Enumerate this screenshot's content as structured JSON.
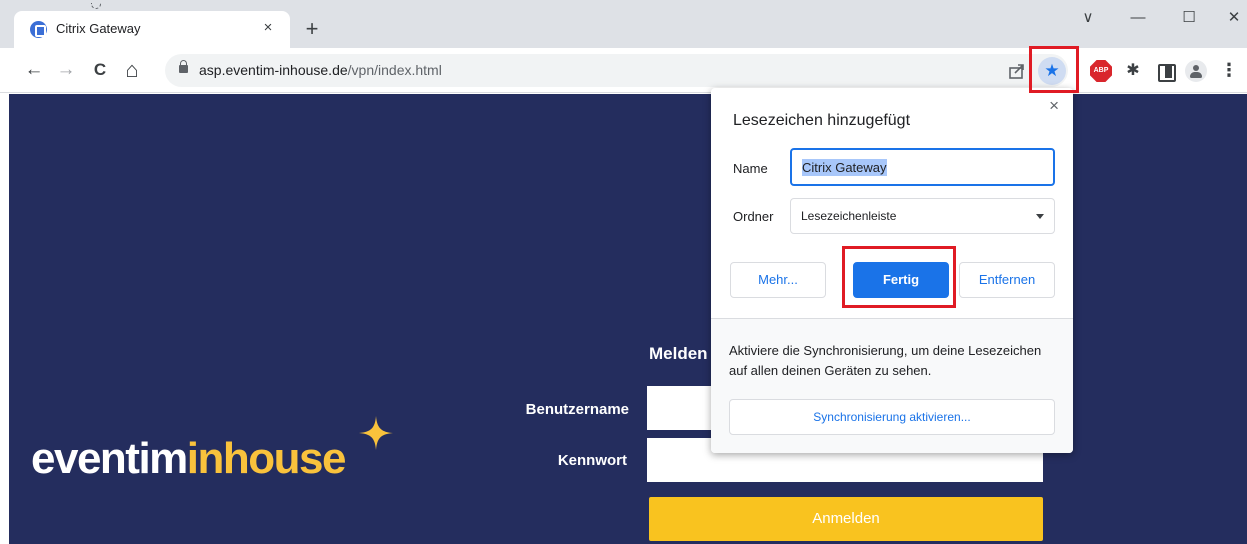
{
  "tab": {
    "title": "Citrix Gateway",
    "close": "×",
    "new": "+"
  },
  "window": {
    "minimize": "—",
    "maximize": "☐",
    "close": "✕",
    "tablist": "∨"
  },
  "toolbar": {
    "back": "←",
    "forward": "→",
    "reload": "C",
    "home": "⌂",
    "url_host": "asp.eventim-inhouse.de",
    "url_path": "/vpn/index.html",
    "star": "★",
    "abp": "ABP",
    "puzzle": "✱",
    "menu": "⋮"
  },
  "page": {
    "logo_part1": "eventim",
    "logo_part2": "inhouse",
    "heading": "Melden",
    "username_label": "Benutzername",
    "password_label": "Kennwort",
    "login_button": "Anmelden"
  },
  "bookmark_popup": {
    "title": "Lesezeichen hinzugefügt",
    "close": "×",
    "name_label": "Name",
    "name_value": "Citrix Gateway",
    "folder_label": "Ordner",
    "folder_value": "Lesezeichenleiste",
    "more_button": "Mehr...",
    "done_button": "Fertig",
    "remove_button": "Entfernen",
    "sync_text": "Aktiviere die Synchronisierung, um deine Lesezeichen auf allen deinen Geräten zu sehen.",
    "sync_button": "Synchronisierung aktivieren..."
  },
  "colors": {
    "page_bg": "#242d5e",
    "accent_yellow": "#f9c31f",
    "chrome_blue": "#1a73e8",
    "highlight_red": "#e01b24"
  }
}
